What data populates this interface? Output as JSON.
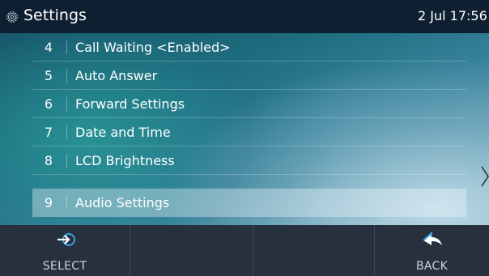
{
  "header": {
    "title": "Settings",
    "clock": "2 Jul 17:56"
  },
  "menu": {
    "items": [
      {
        "number": "4",
        "label": "Call Waiting <Enabled>"
      },
      {
        "number": "5",
        "label": "Auto Answer"
      },
      {
        "number": "6",
        "label": "Forward Settings"
      },
      {
        "number": "7",
        "label": "Date and Time"
      },
      {
        "number": "8",
        "label": "LCD Brightness"
      },
      {
        "number": "9",
        "label": "Audio Settings"
      }
    ],
    "selected_number": "9"
  },
  "softkeys": {
    "select_label": "SELECT",
    "back_label": "BACK"
  },
  "icons": {
    "header": "gear-icon",
    "select": "select-arrow-icon",
    "back": "back-arrow-icon",
    "next": "chevron-right-icon"
  },
  "colors": {
    "header_bg": "#0e1f31",
    "softkey_bg": "#27313d",
    "accent_blue": "#3aa0e0"
  }
}
